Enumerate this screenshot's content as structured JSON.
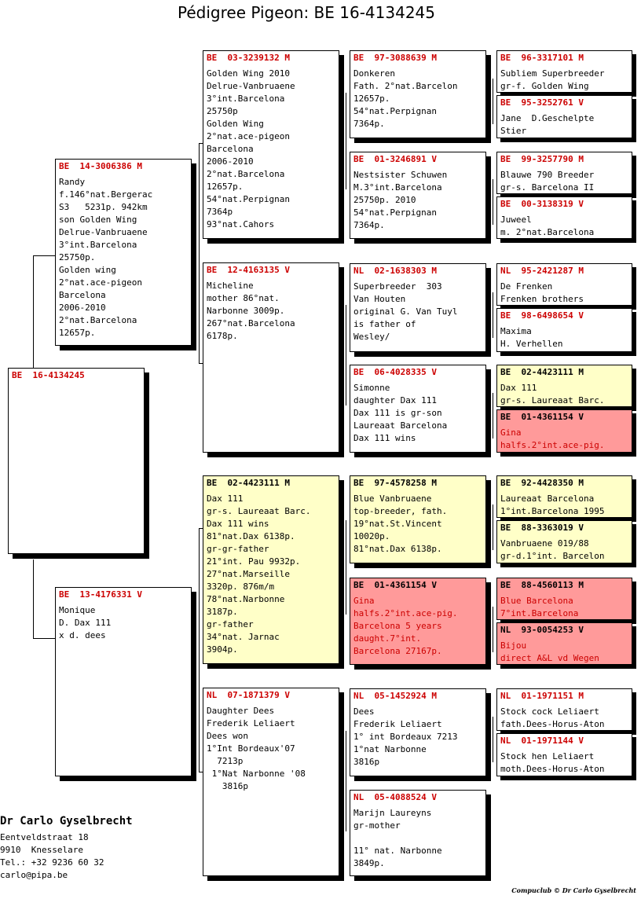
{
  "title": "Pédigree Pigeon: BE  16-4134245",
  "pigeon": {
    "ring": "BE  16-4134245"
  },
  "father": {
    "ring": "BE  14-3006386 M",
    "lines": [
      "Randy",
      "f.146°nat.Bergerac",
      "S3   5231p. 942km",
      "son Golden Wing",
      "Delrue-Vanbruaene",
      "3°int.Barcelona",
      "25750p.",
      "Golden wing",
      "2°nat.ace-pigeon",
      "Barcelona",
      "2006-2010",
      "2°nat.Barcelona",
      "12657p."
    ]
  },
  "mother": {
    "ring": "BE  13-4176331 V",
    "lines": [
      "Monique",
      "D. Dax 111",
      "x d. dees"
    ]
  },
  "ff": {
    "ring": "BE  03-3239132 M",
    "lines": [
      "Golden Wing 2010",
      "Delrue-Vanbruaene",
      "3°int.Barcelona",
      "25750p",
      "Golden Wing",
      "2°nat.ace-pigeon",
      "Barcelona",
      "2006-2010",
      "2°nat.Barcelona",
      "12657p.",
      "54°nat.Perpignan",
      "7364p",
      "93°nat.Cahors"
    ]
  },
  "fm": {
    "ring": "BE  12-4163135 V",
    "lines": [
      "Micheline",
      "mother 86°nat.",
      "Narbonne 3009p.",
      "267°nat.Barcelona",
      "6178p."
    ]
  },
  "mf": {
    "ring": "BE  02-4423111 M",
    "lines": [
      "Dax 111",
      "gr-s. Laureaat Barc.",
      "Dax 111 wins",
      "81°nat.Dax 6138p.",
      "gr-gr-father",
      "21°int. Pau 9932p.",
      "27°nat.Marseille",
      "3320p. 876m/m",
      "78°nat.Narbonne",
      "3187p.",
      "gr-father",
      "34°nat. Jarnac",
      "3904p."
    ]
  },
  "mm": {
    "ring": "NL  07-1871379 V",
    "lines": [
      "Daughter Dees",
      "Frederik Leliaert",
      "Dees won",
      "1°Int Bordeaux'07",
      "  7213p",
      " 1°Nat Narbonne '08",
      "   3816p"
    ]
  },
  "fff": {
    "ring": "BE  97-3088639 M",
    "lines": [
      "Donkeren",
      "Fath. 2°nat.Barcelon",
      "12657p.",
      "54°nat.Perpignan",
      "7364p."
    ]
  },
  "ffm": {
    "ring": "BE  01-3246891 V",
    "lines": [
      "Nestsister Schuwen",
      "M.3°int.Barcelona",
      "25750p. 2010",
      "54°nat.Perpignan",
      "7364p."
    ]
  },
  "fmf": {
    "ring": "NL  02-1638303 M",
    "lines": [
      "Superbreeder  303",
      "Van Houten",
      "original G. Van Tuyl",
      "is father of",
      "Wesley/"
    ]
  },
  "fmm": {
    "ring": "BE  06-4028335 V",
    "lines": [
      "Simonne",
      "daughter Dax 111",
      "Dax 111 is gr-son",
      "Laureaat Barcelona",
      "Dax 111 wins"
    ]
  },
  "mff": {
    "ring": "BE  97-4578258 M",
    "lines": [
      "Blue Vanbruaene",
      "top-breeder, fath.",
      "19°nat.St.Vincent",
      "10020p.",
      "81°nat.Dax 6138p."
    ]
  },
  "mfm": {
    "ring": "BE  01-4361154 V",
    "lines": [
      "Gina",
      "halfs.2°int.ace-pig.",
      "Barcelona 5 years",
      "daught.7°int.",
      "Barcelona 27167p."
    ]
  },
  "mmf": {
    "ring": "NL  05-1452924 M",
    "lines": [
      "Dees",
      "Frederik Leliaert",
      "1° int Bordeaux 7213",
      "1°nat Narbonne",
      "3816p"
    ]
  },
  "mmm": {
    "ring": "NL  05-4088524 V",
    "lines": [
      "Marijn Laureyns",
      "gr-mother",
      "",
      "11° nat. Narbonne",
      "3849p."
    ]
  },
  "g4": [
    {
      "ring": "BE  96-3317101 M",
      "lines": [
        "Subliem Superbreeder",
        "gr-f. Golden Wing"
      ]
    },
    {
      "ring": "BE  95-3252761 V",
      "lines": [
        "Jane  D.Geschelpte",
        "Stier"
      ]
    },
    {
      "ring": "BE  99-3257790 M",
      "lines": [
        "Blauwe 790 Breeder",
        "gr-s. Barcelona II"
      ]
    },
    {
      "ring": "BE  00-3138319 V",
      "lines": [
        "Juweel",
        "m. 2°nat.Barcelona"
      ]
    },
    {
      "ring": "NL  95-2421287 M",
      "lines": [
        "De Frenken",
        "Frenken brothers"
      ]
    },
    {
      "ring": "BE  98-6498654 V",
      "lines": [
        "Maxima",
        "H. Verhellen"
      ]
    },
    {
      "ring": "BE  02-4423111 M",
      "lines": [
        "Dax 111",
        "gr-s. Laureaat Barc."
      ]
    },
    {
      "ring": "BE  01-4361154 V",
      "lines": [
        "Gina",
        "halfs.2°int.ace-pig."
      ]
    },
    {
      "ring": "BE  92-4428350 M",
      "lines": [
        "Laureaat Barcelona",
        "1°int.Barcelona 1995"
      ]
    },
    {
      "ring": "BE  88-3363019 V",
      "lines": [
        "Vanbruaene 019/88",
        "gr-d.1°int. Barcelon"
      ]
    },
    {
      "ring": "BE  88-4560113 M",
      "lines": [
        "Blue Barcelona",
        "7°int.Barcelona"
      ]
    },
    {
      "ring": "NL  93-0054253 V",
      "lines": [
        "Bijou",
        "direct A&L vd Wegen"
      ]
    },
    {
      "ring": "NL  01-1971151 M",
      "lines": [
        "Stock cock Leliaert",
        "fath.Dees-Horus-Aton"
      ]
    },
    {
      "ring": "NL  01-1971144 V",
      "lines": [
        "Stock hen Leliaert",
        "moth.Dees-Horus-Aton"
      ]
    }
  ],
  "breeder": {
    "name": "Dr Carlo Gyselbrecht",
    "address": "Eentveldstraat 18",
    "city": "9910  Knesselare",
    "phone": "Tel.: +32 9236 60 32",
    "email": "carlo@pipa.be"
  },
  "footer": "Compuclub © Dr Carlo Gyselbrecht"
}
